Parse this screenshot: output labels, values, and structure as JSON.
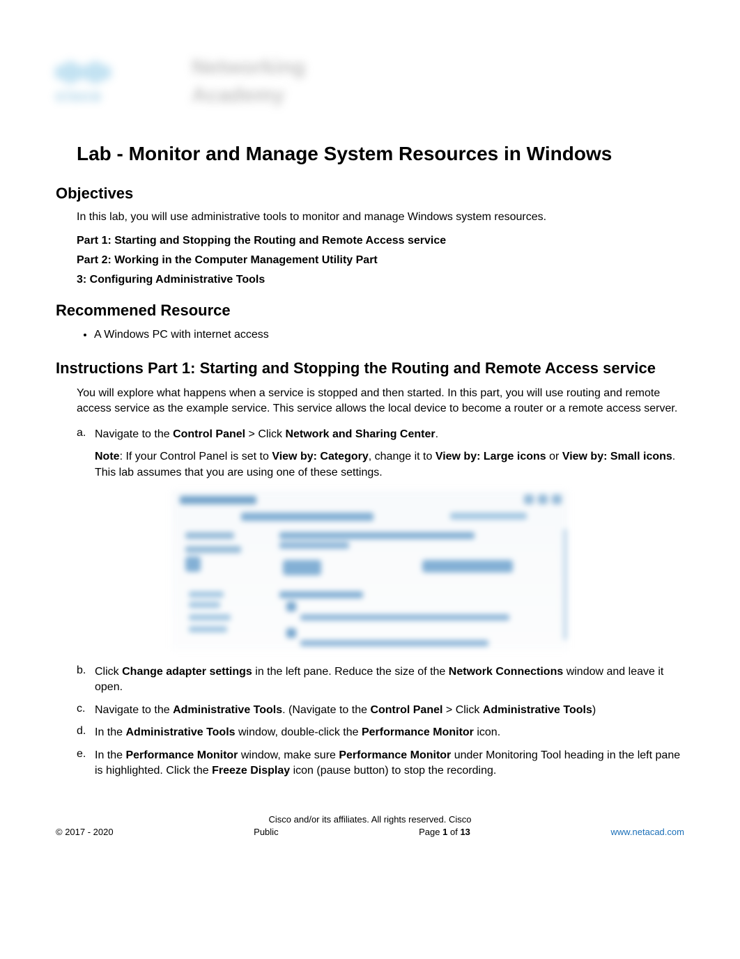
{
  "logo": {
    "brand": "cisco",
    "line1": "Networking",
    "line2": "Academy"
  },
  "title": "Lab - Monitor and Manage System Resources in Windows",
  "objectives": {
    "heading": "Objectives",
    "intro": "In this lab, you will use administrative tools to monitor and manage Windows system resources.",
    "part1": "Part 1: Starting and Stopping the Routing and Remote Access service",
    "part2": "Part 2: Working in the Computer Management Utility Part",
    "part3": "3: Configuring Administrative Tools"
  },
  "recommended": {
    "heading": "Recommened Resource",
    "item1": "A Windows PC with internet access"
  },
  "instructions": {
    "heading": "Instructions Part 1: Starting and Stopping the Routing and Remote Access service",
    "intro": "You will explore what happens when a service is stopped and then started. In this part, you will use routing and remote access service as the example service. This service allows the local device to become a router or a remote access server.",
    "a": {
      "letter": "a.",
      "pre": "Navigate to the ",
      "b1": "Control Panel",
      "mid": " > Click ",
      "b2": "Network and Sharing Center",
      "post": "."
    },
    "note": {
      "label": "Note",
      "t1": ": If your Control Panel is set to ",
      "b1": "View by: Category",
      "t2": ", change it to ",
      "b2": "View by: Large icons",
      "t3": " or ",
      "b3": "View by: Small icons",
      "t4": ". This lab assumes that you are using one of these settings."
    },
    "b": {
      "letter": "b.",
      "t1": "Click ",
      "b1": "Change adapter settings",
      "t2": " in the left pane. Reduce the size of the ",
      "b2": "Network Connections",
      "t3": " window and leave it open."
    },
    "c": {
      "letter": "c.",
      "t1": "Navigate to the ",
      "b1": "Administrative Tools",
      "t2": ". (Navigate to the ",
      "b2": "Control Panel",
      "t3": " > Click ",
      "b3": "Administrative Tools",
      "t4": ")"
    },
    "d": {
      "letter": "d.",
      "t1": "In the ",
      "b1": "Administrative Tools",
      "t2": " window, double-click the ",
      "b2": "Performance Monitor",
      "t3": " icon."
    },
    "e": {
      "letter": "e.",
      "t1": "In the ",
      "b1": "Performance Monitor",
      "t2": " window, make sure ",
      "b2": "Performance Monitor",
      "t3": " under Monitoring Tool heading in the left pane is highlighted. Click the ",
      "b3": "Freeze Display",
      "t4": " icon (pause button) to stop the recording."
    }
  },
  "footer": {
    "rights": "Cisco and/or its affiliates. All rights reserved. Cisco",
    "copyright": "© 2017 - 2020",
    "classification": "Public",
    "page_pre": "Page ",
    "page_num": "1",
    "page_mid": " of ",
    "page_total": "13",
    "link": "www.netacad.com"
  }
}
